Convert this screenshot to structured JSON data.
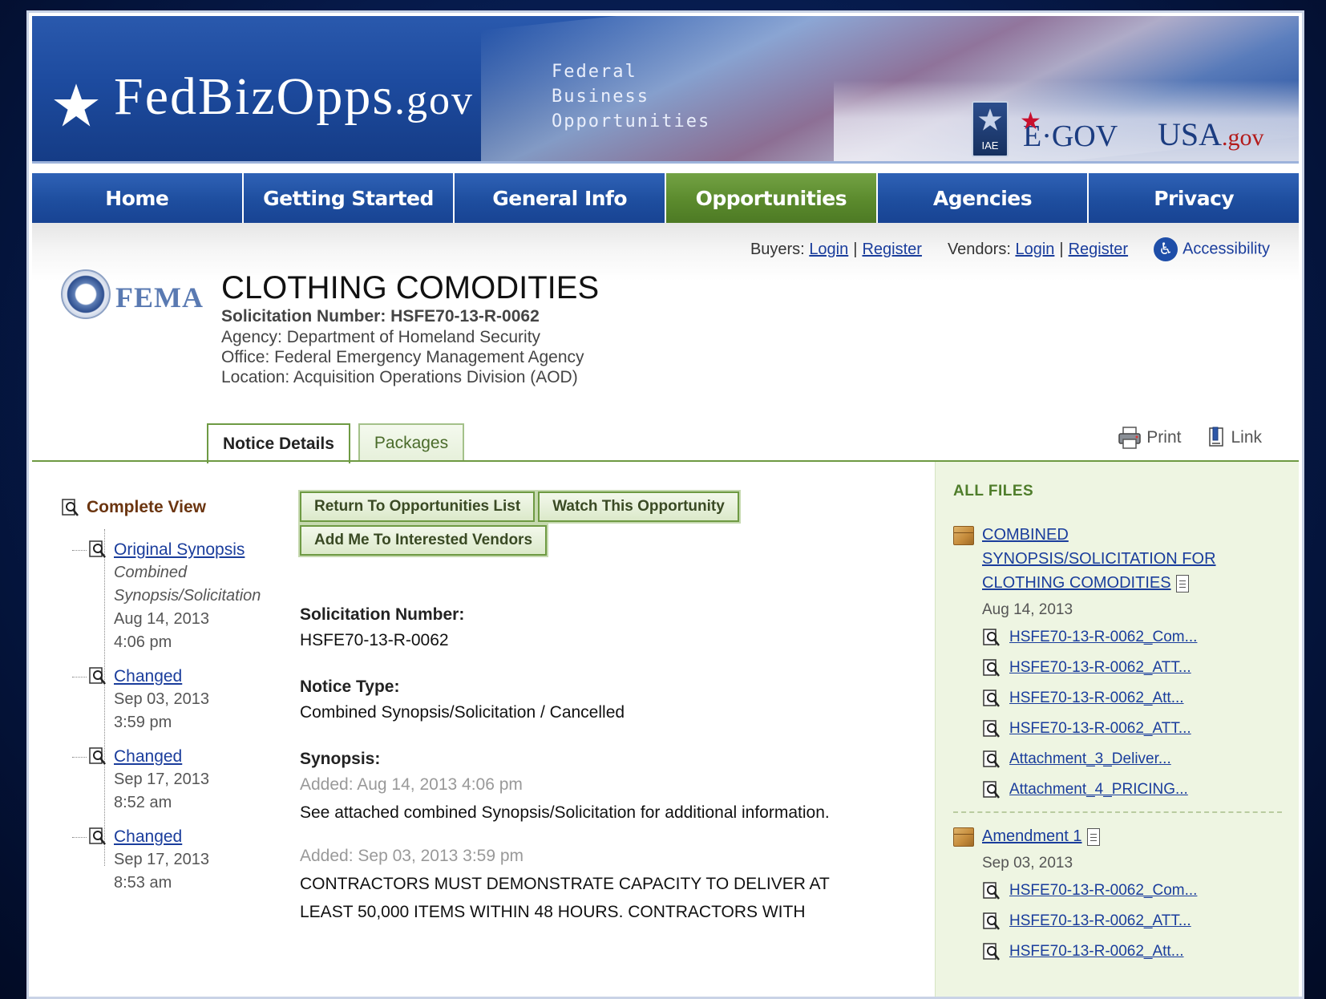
{
  "banner": {
    "logo_main": "FedBizOpps",
    "logo_suffix": ".gov",
    "tagline": [
      "Federal",
      "Business",
      "Opportunities"
    ],
    "partner_iae": "IAE",
    "partner_egov": "E·GOV",
    "partner_usa": "USA",
    "partner_usa_suffix": ".gov"
  },
  "nav": {
    "items": [
      {
        "label": "Home",
        "active": false
      },
      {
        "label": "Getting Started",
        "active": false
      },
      {
        "label": "General Info",
        "active": false
      },
      {
        "label": "Opportunities",
        "active": true
      },
      {
        "label": "Agencies",
        "active": false
      },
      {
        "label": "Privacy",
        "active": false
      }
    ]
  },
  "account": {
    "buyers_label": "Buyers:",
    "buyers_login": "Login",
    "buyers_register": "Register",
    "vendors_label": "Vendors:",
    "vendors_login": "Login",
    "vendors_register": "Register",
    "accessibility": "Accessibility",
    "sep": "|"
  },
  "agency_logo": {
    "word": "FEMA"
  },
  "notice": {
    "title": "CLOTHING COMODITIES",
    "solicitation_line": "Solicitation Number: HSFE70-13-R-0062",
    "agency_line": "Agency: Department of Homeland Security",
    "office_line": "Office: Federal Emergency Management Agency",
    "location_line": "Location: Acquisition Operations Division (AOD)"
  },
  "tabs": [
    {
      "label": "Notice Details",
      "active": true
    },
    {
      "label": "Packages",
      "active": false
    }
  ],
  "tools": {
    "print": "Print",
    "link": "Link"
  },
  "tree": {
    "complete_view": "Complete View",
    "nodes": [
      {
        "link": "Original Synopsis",
        "sub1": "Combined",
        "sub2": "Synopsis/Solicitation",
        "date": "Aug 14, 2013",
        "time": "4:06 pm"
      },
      {
        "link": "Changed",
        "date": "Sep 03, 2013",
        "time": "3:59 pm"
      },
      {
        "link": "Changed",
        "date": "Sep 17, 2013",
        "time": "8:52 am"
      },
      {
        "link": "Changed",
        "date": "Sep 17, 2013",
        "time": "8:53 am"
      }
    ]
  },
  "actions": {
    "return_list": "Return To Opportunities List",
    "watch": "Watch This Opportunity",
    "interested": "Add Me To Interested Vendors"
  },
  "details": {
    "sol_label": "Solicitation Number:",
    "sol_value": "HSFE70-13-R-0062",
    "type_label": "Notice Type:",
    "type_value": "Combined Synopsis/Solicitation / Cancelled",
    "synopsis_label": "Synopsis:",
    "added1": "Added: Aug 14, 2013 4:06 pm",
    "text1": "See attached combined Synopsis/Solicitation for additional information.",
    "added2": "Added: Sep 03, 2013 3:59 pm",
    "text2_line1": "CONTRACTORS MUST DEMONSTRATE CAPACITY TO DELIVER AT",
    "text2_line2": "LEAST 50,000 ITEMS WITHIN 48 HOURS. CONTRACTORS WITH"
  },
  "files": {
    "title": "ALL FILES",
    "pkg1": {
      "line1": "COMBINED",
      "line2": "SYNOPSIS/SOLICITATION FOR",
      "line3": "CLOTHING COMODITIES",
      "date": "Aug 14, 2013",
      "files": [
        "HSFE70-13-R-0062_Com...",
        "HSFE70-13-R-0062_ATT...",
        "HSFE70-13-R-0062_Att...",
        "HSFE70-13-R-0062_ATT...",
        "Attachment_3_Deliver...",
        "Attachment_4_PRICING..."
      ]
    },
    "pkg2": {
      "title": "Amendment 1",
      "date": "Sep 03, 2013",
      "files": [
        "HSFE70-13-R-0062_Com...",
        "HSFE70-13-R-0062_ATT...",
        "HSFE70-13-R-0062_Att..."
      ]
    }
  },
  "colors": {
    "nav_blue": "#1e4e9f",
    "nav_active_green": "#5b8a2d",
    "link_blue": "#1a3d9c",
    "files_panel_bg": "#eef5e2"
  }
}
